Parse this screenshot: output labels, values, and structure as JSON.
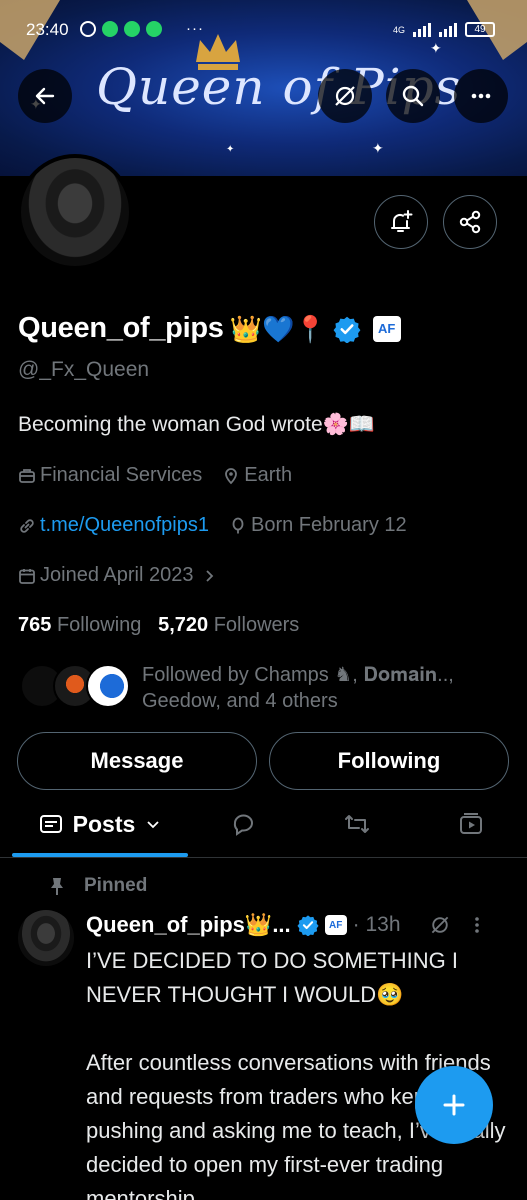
{
  "status_bar": {
    "time": "23:40",
    "network": "4G",
    "battery": "49"
  },
  "banner": {
    "title": "Queen of Pips"
  },
  "profile": {
    "name": "Queen_of_pips",
    "name_emojis": "👑💙📍",
    "affiliate_badge": "AF",
    "handle": "@_Fx_Queen",
    "bio": "Becoming the woman God wrote🌸📖",
    "category": "Financial Services",
    "location": "Earth",
    "link": "t.me/Queenofpips1",
    "birthday": "Born February 12",
    "joined": "Joined April 2023",
    "following_count": "765",
    "following_label": "Following",
    "followers_count": "5,720",
    "followers_label": "Followers",
    "followed_by": "Followed by Champs ♞, 𝐃𝐨𝐦𝐚𝐢𝐧.., Geedow, and 4 others"
  },
  "buttons": {
    "message": "Message",
    "following": "Following"
  },
  "tabs": {
    "posts": "Posts"
  },
  "pinned_post": {
    "pinned_label": "Pinned",
    "author": "Queen_of_pips👑...",
    "badge": "AF",
    "time": "· 13h",
    "text": "I’VE DECIDED TO DO SOMETHING I NEVER THOUGHT I WOULD🥹\n\nAfter countless conversations with friends and requests from traders who kept pushing and asking me to teach, I’ve finally decided to open my first-ever trading mentorship"
  },
  "colors": {
    "accent": "#1d9bf0",
    "muted": "#71767b",
    "border": "#536471",
    "banner": "#0f2a78"
  },
  "icons": [
    "back-arrow-icon",
    "hide-icon",
    "search-icon",
    "more-icon",
    "bell-plus-icon",
    "share-icon",
    "briefcase-icon",
    "location-icon",
    "link-icon",
    "balloon-icon",
    "calendar-icon",
    "chevron-right-icon",
    "posts-icon",
    "chevron-down-icon",
    "reply-icon",
    "repost-icon",
    "media-icon",
    "pin-icon",
    "verified-icon",
    "plus-icon"
  ]
}
